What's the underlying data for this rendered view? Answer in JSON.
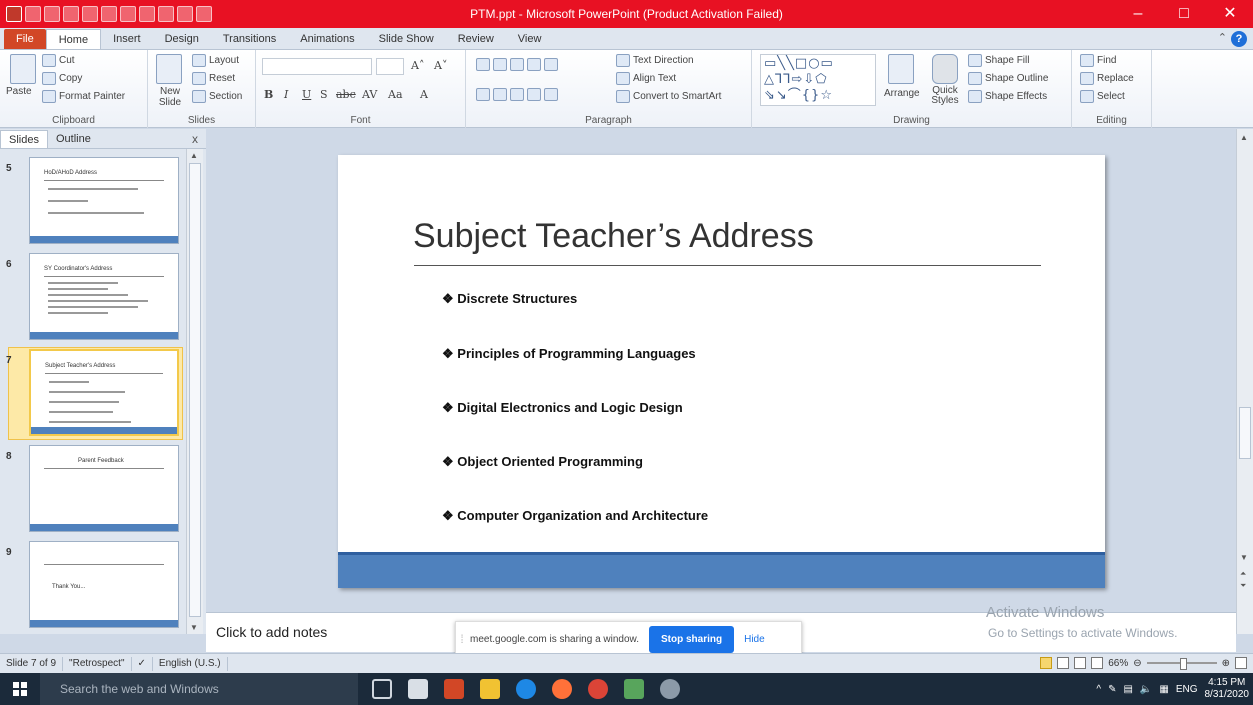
{
  "window": {
    "title": "PTM.ppt  -  Microsoft PowerPoint (Product Activation Failed)",
    "minimize": "–",
    "maximize": "□",
    "close": "✕"
  },
  "tabs": [
    "File",
    "Home",
    "Insert",
    "Design",
    "Transitions",
    "Animations",
    "Slide Show",
    "Review",
    "View"
  ],
  "ribbon": {
    "clipboard": {
      "paste": "Paste",
      "cut": "Cut",
      "copy": "Copy",
      "format_painter": "Format Painter",
      "label": "Clipboard"
    },
    "slides": {
      "new_slide": "New Slide",
      "layout": "Layout",
      "reset": "Reset",
      "section": "Section",
      "label": "Slides"
    },
    "font": {
      "label": "Font",
      "bold": "B",
      "italic": "I",
      "underline": "U",
      "strike": "S",
      "abc": "abc",
      "av": "AV",
      "aa": "Aa",
      "a": "A"
    },
    "paragraph": {
      "label": "Paragraph",
      "text_direction": "Text Direction",
      "align_text": "Align Text",
      "convert_smartart": "Convert to SmartArt"
    },
    "drawing": {
      "label": "Drawing",
      "arrange": "Arrange",
      "quick_styles": "Quick Styles",
      "shape_fill": "Shape Fill",
      "shape_outline": "Shape Outline",
      "shape_effects": "Shape Effects"
    },
    "editing": {
      "label": "Editing",
      "find": "Find",
      "replace": "Replace",
      "select": "Select"
    }
  },
  "left_pane": {
    "tab_slides": "Slides",
    "tab_outline": "Outline",
    "close": "x",
    "thumbnails": [
      {
        "num": "5",
        "title": "HoD/AHoD Address"
      },
      {
        "num": "6",
        "title": "SY Coordinator's Address"
      },
      {
        "num": "7",
        "title": "Subject Teacher's Address"
      },
      {
        "num": "8",
        "title": "Parent Feedback"
      },
      {
        "num": "9",
        "title": "Thank You..."
      }
    ]
  },
  "slide": {
    "title": "Subject Teacher’s Address",
    "bullets": [
      "Discrete Structures",
      "Principles of Programming Languages",
      "Digital Electronics and Logic Design",
      "Object Oriented Programming",
      "Computer Organization and Architecture"
    ],
    "bullet_char": "❖"
  },
  "notes": {
    "placeholder": "Click to add notes"
  },
  "share_banner": {
    "message": "meet.google.com is sharing a window.",
    "stop": "Stop sharing",
    "hide": "Hide"
  },
  "watermark": {
    "line1": "Activate Windows",
    "line2": "Go to Settings to activate Windows."
  },
  "status": {
    "slide_count": "Slide 7 of 9",
    "theme": "\"Retrospect\"",
    "language": "English (U.S.)",
    "zoom": "66%"
  },
  "taskbar": {
    "search": "Search the web and Windows",
    "lang": "ENG",
    "time": "4:15 PM",
    "date": "8/31/2020"
  }
}
